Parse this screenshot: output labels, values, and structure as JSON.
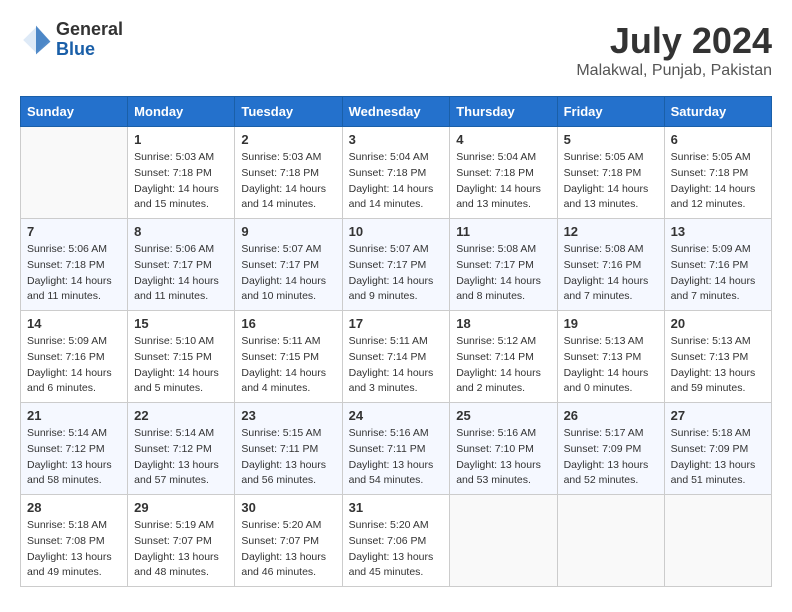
{
  "header": {
    "logo_general": "General",
    "logo_blue": "Blue",
    "month_year": "July 2024",
    "location": "Malakwal, Punjab, Pakistan"
  },
  "days_of_week": [
    "Sunday",
    "Monday",
    "Tuesday",
    "Wednesday",
    "Thursday",
    "Friday",
    "Saturday"
  ],
  "weeks": [
    [
      {
        "day": "",
        "info": ""
      },
      {
        "day": "1",
        "info": "Sunrise: 5:03 AM\nSunset: 7:18 PM\nDaylight: 14 hours\nand 15 minutes."
      },
      {
        "day": "2",
        "info": "Sunrise: 5:03 AM\nSunset: 7:18 PM\nDaylight: 14 hours\nand 14 minutes."
      },
      {
        "day": "3",
        "info": "Sunrise: 5:04 AM\nSunset: 7:18 PM\nDaylight: 14 hours\nand 14 minutes."
      },
      {
        "day": "4",
        "info": "Sunrise: 5:04 AM\nSunset: 7:18 PM\nDaylight: 14 hours\nand 13 minutes."
      },
      {
        "day": "5",
        "info": "Sunrise: 5:05 AM\nSunset: 7:18 PM\nDaylight: 14 hours\nand 13 minutes."
      },
      {
        "day": "6",
        "info": "Sunrise: 5:05 AM\nSunset: 7:18 PM\nDaylight: 14 hours\nand 12 minutes."
      }
    ],
    [
      {
        "day": "7",
        "info": "Sunrise: 5:06 AM\nSunset: 7:18 PM\nDaylight: 14 hours\nand 11 minutes."
      },
      {
        "day": "8",
        "info": "Sunrise: 5:06 AM\nSunset: 7:17 PM\nDaylight: 14 hours\nand 11 minutes."
      },
      {
        "day": "9",
        "info": "Sunrise: 5:07 AM\nSunset: 7:17 PM\nDaylight: 14 hours\nand 10 minutes."
      },
      {
        "day": "10",
        "info": "Sunrise: 5:07 AM\nSunset: 7:17 PM\nDaylight: 14 hours\nand 9 minutes."
      },
      {
        "day": "11",
        "info": "Sunrise: 5:08 AM\nSunset: 7:17 PM\nDaylight: 14 hours\nand 8 minutes."
      },
      {
        "day": "12",
        "info": "Sunrise: 5:08 AM\nSunset: 7:16 PM\nDaylight: 14 hours\nand 7 minutes."
      },
      {
        "day": "13",
        "info": "Sunrise: 5:09 AM\nSunset: 7:16 PM\nDaylight: 14 hours\nand 7 minutes."
      }
    ],
    [
      {
        "day": "14",
        "info": "Sunrise: 5:09 AM\nSunset: 7:16 PM\nDaylight: 14 hours\nand 6 minutes."
      },
      {
        "day": "15",
        "info": "Sunrise: 5:10 AM\nSunset: 7:15 PM\nDaylight: 14 hours\nand 5 minutes."
      },
      {
        "day": "16",
        "info": "Sunrise: 5:11 AM\nSunset: 7:15 PM\nDaylight: 14 hours\nand 4 minutes."
      },
      {
        "day": "17",
        "info": "Sunrise: 5:11 AM\nSunset: 7:14 PM\nDaylight: 14 hours\nand 3 minutes."
      },
      {
        "day": "18",
        "info": "Sunrise: 5:12 AM\nSunset: 7:14 PM\nDaylight: 14 hours\nand 2 minutes."
      },
      {
        "day": "19",
        "info": "Sunrise: 5:13 AM\nSunset: 7:13 PM\nDaylight: 14 hours\nand 0 minutes."
      },
      {
        "day": "20",
        "info": "Sunrise: 5:13 AM\nSunset: 7:13 PM\nDaylight: 13 hours\nand 59 minutes."
      }
    ],
    [
      {
        "day": "21",
        "info": "Sunrise: 5:14 AM\nSunset: 7:12 PM\nDaylight: 13 hours\nand 58 minutes."
      },
      {
        "day": "22",
        "info": "Sunrise: 5:14 AM\nSunset: 7:12 PM\nDaylight: 13 hours\nand 57 minutes."
      },
      {
        "day": "23",
        "info": "Sunrise: 5:15 AM\nSunset: 7:11 PM\nDaylight: 13 hours\nand 56 minutes."
      },
      {
        "day": "24",
        "info": "Sunrise: 5:16 AM\nSunset: 7:11 PM\nDaylight: 13 hours\nand 54 minutes."
      },
      {
        "day": "25",
        "info": "Sunrise: 5:16 AM\nSunset: 7:10 PM\nDaylight: 13 hours\nand 53 minutes."
      },
      {
        "day": "26",
        "info": "Sunrise: 5:17 AM\nSunset: 7:09 PM\nDaylight: 13 hours\nand 52 minutes."
      },
      {
        "day": "27",
        "info": "Sunrise: 5:18 AM\nSunset: 7:09 PM\nDaylight: 13 hours\nand 51 minutes."
      }
    ],
    [
      {
        "day": "28",
        "info": "Sunrise: 5:18 AM\nSunset: 7:08 PM\nDaylight: 13 hours\nand 49 minutes."
      },
      {
        "day": "29",
        "info": "Sunrise: 5:19 AM\nSunset: 7:07 PM\nDaylight: 13 hours\nand 48 minutes."
      },
      {
        "day": "30",
        "info": "Sunrise: 5:20 AM\nSunset: 7:07 PM\nDaylight: 13 hours\nand 46 minutes."
      },
      {
        "day": "31",
        "info": "Sunrise: 5:20 AM\nSunset: 7:06 PM\nDaylight: 13 hours\nand 45 minutes."
      },
      {
        "day": "",
        "info": ""
      },
      {
        "day": "",
        "info": ""
      },
      {
        "day": "",
        "info": ""
      }
    ]
  ]
}
